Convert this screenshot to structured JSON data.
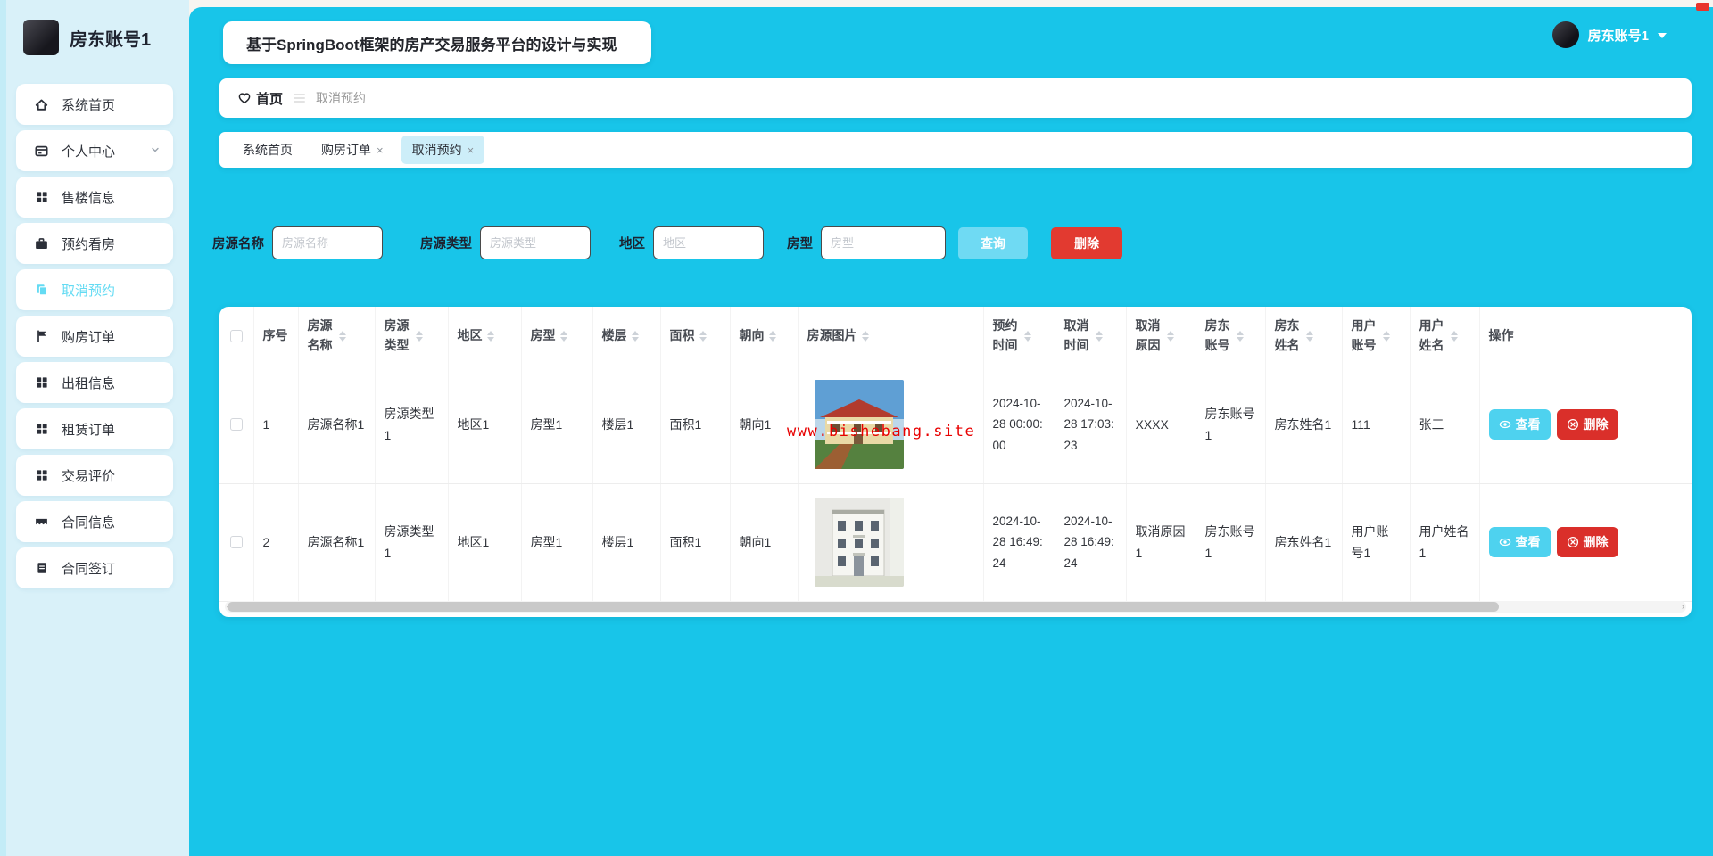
{
  "app": {
    "title": "基于SpringBoot框架的房产交易服务平台的设计与实现"
  },
  "topbar": {
    "user_name": "房东账号1"
  },
  "sidebar": {
    "account_name": "房东账号1",
    "items": [
      {
        "label": "系统首页",
        "icon": "home-icon"
      },
      {
        "label": "个人中心",
        "icon": "card-icon"
      },
      {
        "label": "售楼信息",
        "icon": "grid-icon"
      },
      {
        "label": "预约看房",
        "icon": "briefcase-icon"
      },
      {
        "label": "取消预约",
        "icon": "pages-icon",
        "active": true
      },
      {
        "label": "购房订单",
        "icon": "flag-icon"
      },
      {
        "label": "出租信息",
        "icon": "grid-icon"
      },
      {
        "label": "租赁订单",
        "icon": "grid-icon"
      },
      {
        "label": "交易评价",
        "icon": "grid-icon"
      },
      {
        "label": "合同信息",
        "icon": "ticket-icon"
      },
      {
        "label": "合同签订",
        "icon": "document-icon"
      }
    ]
  },
  "breadcrumb": {
    "home": "首页",
    "current": "取消预约"
  },
  "tabs": {
    "close_symbol": "×",
    "items": [
      {
        "label": "系统首页",
        "closable": false
      },
      {
        "label": "购房订单",
        "closable": true
      },
      {
        "label": "取消预约",
        "closable": true,
        "active": true
      }
    ]
  },
  "filters": {
    "fields": [
      {
        "label": "房源名称",
        "placeholder": "房源名称"
      },
      {
        "label": "房源类型",
        "placeholder": "房源类型"
      },
      {
        "label": "地区",
        "placeholder": "地区"
      },
      {
        "label": "房型",
        "placeholder": "房型"
      }
    ],
    "search_label": "查询",
    "delete_label": "删除"
  },
  "watermark": "www.bishebang.site",
  "table": {
    "columns": [
      "序号",
      "房源名称",
      "房源类型",
      "地区",
      "房型",
      "楼层",
      "面积",
      "朝向",
      "房源图片",
      "预约时间",
      "取消时间",
      "取消原因",
      "房东账号",
      "房东姓名",
      "用户账号",
      "用户姓名",
      "操作"
    ],
    "view_label": "查看",
    "delete_label": "删除",
    "rows": [
      {
        "idx": "1",
        "name": "房源名称1",
        "type": "房源类型1",
        "region": "地区1",
        "room": "房型1",
        "floor": "楼层1",
        "area": "面积1",
        "facing": "朝向1",
        "book_time": "2024-10-28 00:00:00",
        "cancel_time": "2024-10-28 17:03:23",
        "reason": "XXXX",
        "landlord_acct": "房东账号1",
        "landlord_name": "房东姓名1",
        "user_acct": "111",
        "user_name": "张三"
      },
      {
        "idx": "2",
        "name": "房源名称1",
        "type": "房源类型1",
        "region": "地区1",
        "room": "房型1",
        "floor": "楼层1",
        "area": "面积1",
        "facing": "朝向1",
        "book_time": "2024-10-28 16:49:24",
        "cancel_time": "2024-10-28 16:49:24",
        "reason": "取消原因1",
        "landlord_acct": "房东账号1",
        "landlord_name": "房东姓名1",
        "user_acct": "用户账号1",
        "user_name": "用户姓名1"
      }
    ]
  },
  "colors": {
    "main_bg": "#18c5e9",
    "sidebar_bg": "#d9f1f9",
    "active_item": "#64dbf3",
    "search_btn": "#6fdaf3",
    "delete_btn": "#e23a30",
    "tab_active_bg": "#cdeef9",
    "watermark": "#e80000"
  }
}
